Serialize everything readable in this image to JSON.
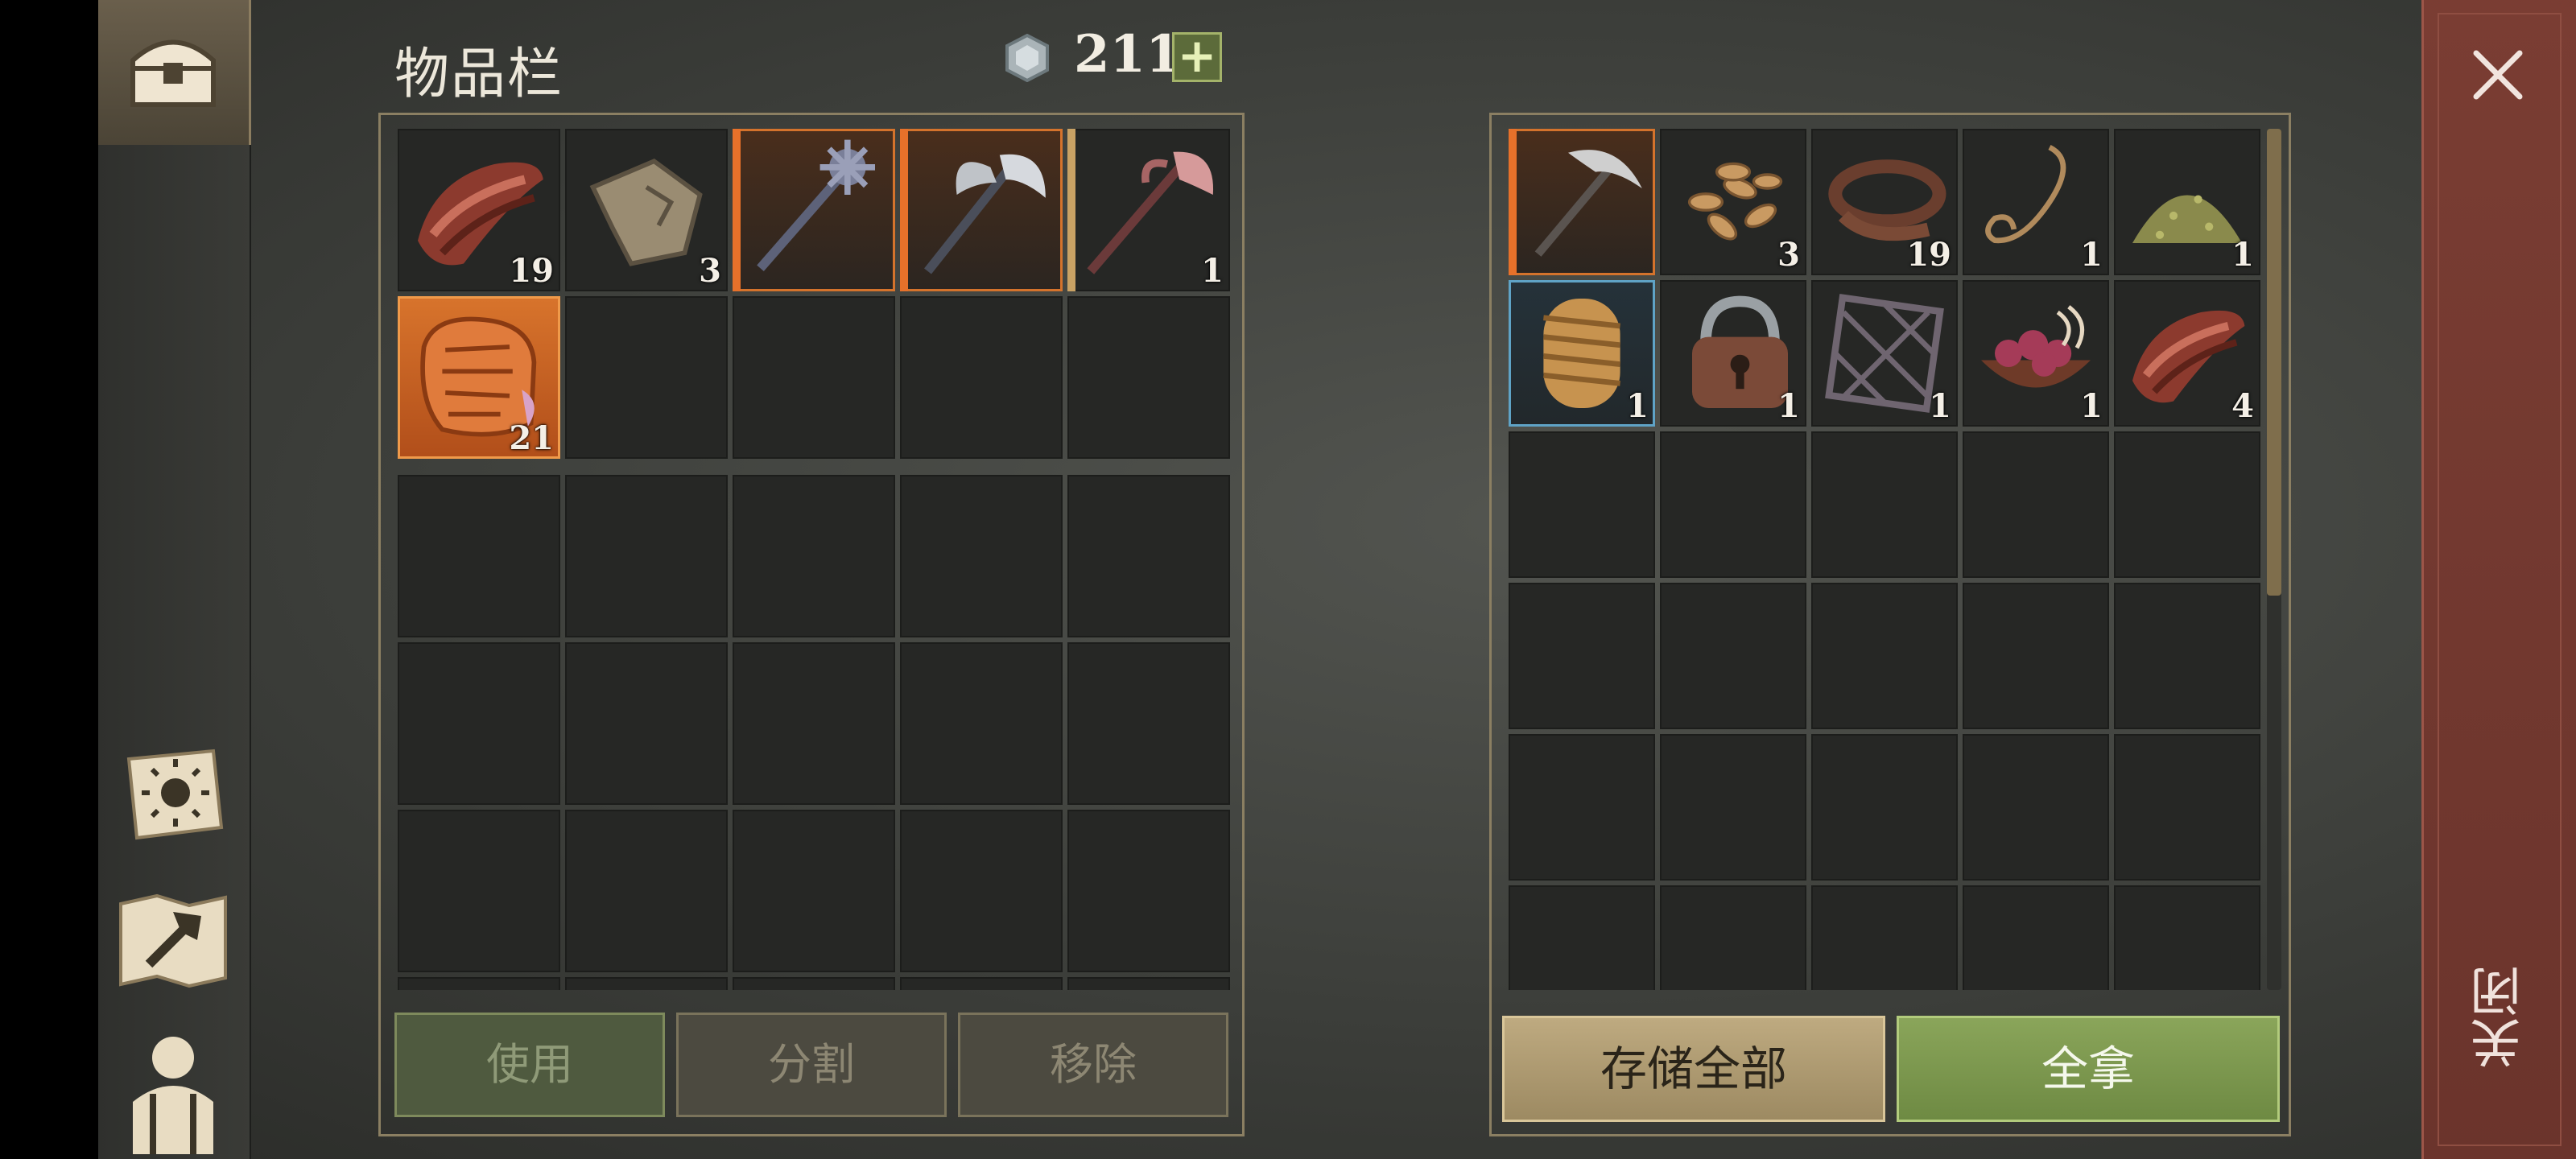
{
  "inventory": {
    "title": "物品栏",
    "currency": "211",
    "add_label": "+",
    "slots": [
      {
        "item": "meat-icon",
        "qty": "19",
        "style": "normal"
      },
      {
        "item": "leather-scrap-icon",
        "qty": "3",
        "style": "normal"
      },
      {
        "item": "mace-icon",
        "qty": "",
        "style": "orangebar"
      },
      {
        "item": "battle-axe-icon",
        "qty": "",
        "style": "orangebar"
      },
      {
        "item": "axe-icon",
        "qty": "1",
        "style": "yellowbar"
      },
      {
        "item": "clay-tablet-icon",
        "qty": "21",
        "style": "full-orange"
      }
    ],
    "actions": {
      "use": "使用",
      "split": "分割",
      "remove": "移除"
    }
  },
  "container": {
    "slots": [
      {
        "item": "pickaxe-icon",
        "qty": "",
        "style": "orangebar"
      },
      {
        "item": "seeds-icon",
        "qty": "3",
        "style": "normal"
      },
      {
        "item": "leather-strip-icon",
        "qty": "19",
        "style": "normal"
      },
      {
        "item": "rope-icon",
        "qty": "1",
        "style": "normal"
      },
      {
        "item": "powder-pile-icon",
        "qty": "1",
        "style": "normal"
      },
      {
        "item": "rope-bundle-icon",
        "qty": "1",
        "style": "blue"
      },
      {
        "item": "padlock-icon",
        "qty": "1",
        "style": "normal"
      },
      {
        "item": "lattice-icon",
        "qty": "1",
        "style": "normal"
      },
      {
        "item": "berries-bowl-icon",
        "qty": "1",
        "style": "normal"
      },
      {
        "item": "meat-icon",
        "qty": "4",
        "style": "normal"
      }
    ],
    "actions": {
      "store_all": "存储全部",
      "take_all": "全拿"
    }
  },
  "close": {
    "label": "关闭"
  }
}
